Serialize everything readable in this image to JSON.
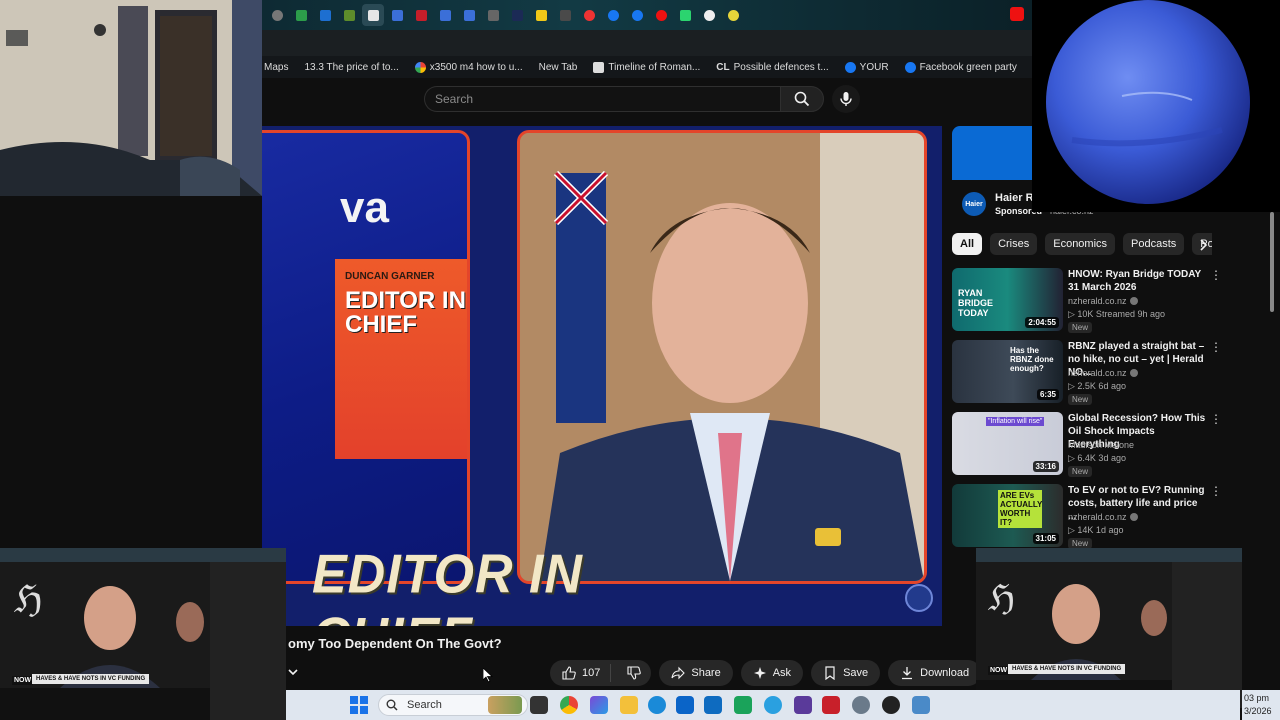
{
  "browser": {
    "bookmarks": [
      {
        "label": "Maps",
        "color": "#4285f4"
      },
      {
        "label": "13.3 The price of to...",
        "color": "#666666"
      },
      {
        "label": "x3500 m4 how to u...",
        "color": "#34a853"
      },
      {
        "label": "New Tab",
        "color": "#444444"
      },
      {
        "label": "Timeline of Roman...",
        "color": "#999999"
      },
      {
        "label": "Possible defences t...",
        "color": "#dddddd"
      },
      {
        "label": "YOUR",
        "color": "#1877f2"
      },
      {
        "label": "Facebook green party",
        "color": "#1877f2"
      }
    ]
  },
  "header": {
    "search_placeholder": "Search"
  },
  "video": {
    "poster_small": "DUNCAN GARNER",
    "poster_big": "EDITOR IN CHIEF",
    "logo_fragment": "va",
    "banner": "EDITOR IN CHIEF",
    "title": "omy Too Dependent On The Govt?",
    "like_count": "107",
    "share_label": "Share",
    "ask_label": "Ask",
    "save_label": "Save",
    "download_label": "Download"
  },
  "sidebar": {
    "ad": {
      "title": "Haier Re",
      "sponsored": "Sponsored",
      "domain": "haier.co.nz",
      "logo_text": "Haier"
    },
    "chips": [
      "All",
      "Crises",
      "Economics",
      "Podcasts",
      "Poli"
    ],
    "recommendations": [
      {
        "title": "HNOW: Ryan Bridge TODAY 31 March 2026",
        "channel": "nzherald.co.nz",
        "meta": "▷ 10K  Streamed 9h ago",
        "badge": "New",
        "duration": "2:04:55",
        "thumb_text": "RYAN BRIDGE TODAY"
      },
      {
        "title": "RBNZ played a straight bat – no hike, no cut – yet | Herald NO...",
        "channel": "nzherald.co.nz",
        "meta": "▷ 2.5K  6d ago",
        "badge": "New",
        "duration": "6:35",
        "thumb_text": "Has the RBNZ done enough?"
      },
      {
        "title": "Global Recession? How This Oil Shock Impacts Everything",
        "channel": "Madison Malone",
        "meta": "▷ 6.4K  3d ago",
        "badge": "New",
        "duration": "33:16",
        "thumb_text": "\"Inflation will rise\""
      },
      {
        "title": "To EV or not to EV? Running costs, battery life and price ...",
        "channel": "nzherald.co.nz",
        "meta": "▷ 14K  1d ago",
        "badge": "New",
        "duration": "31:05",
        "thumb_text": "ARE EVs ACTUALLY WORTH IT?"
      }
    ]
  },
  "overlays": {
    "mini_now": "NOW",
    "mini_title": "HAVES & HAVE NOTS IN VC FUNDING"
  },
  "taskbar": {
    "search_label": "Search",
    "clock_time": "03 pm",
    "clock_date": "3/2026"
  }
}
